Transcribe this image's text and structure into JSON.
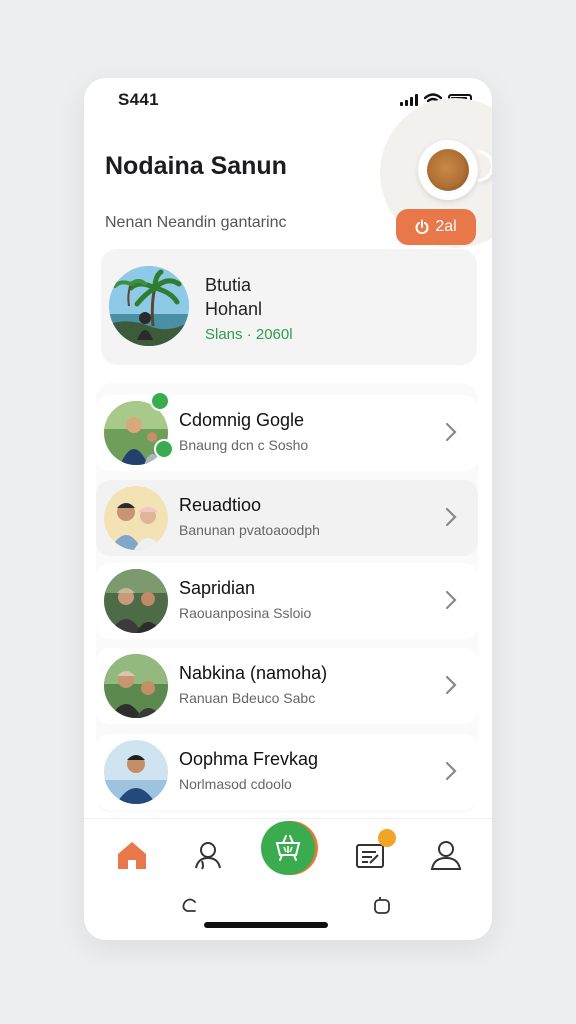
{
  "status_bar": {
    "time": "S441"
  },
  "header": {
    "title": "Nodaina Sanun",
    "subtitle": "Nenan Neandin gantarinc",
    "badge_icon": "power-icon",
    "badge_label": "2al",
    "accent_color": "#e8774a"
  },
  "profile": {
    "name_line1": "Btutia",
    "name_line2": "Hohanl",
    "meta": "Slans · 2060l",
    "meta_color": "#2e9e4b"
  },
  "contacts": [
    {
      "name": "Cdomnig Gogle",
      "subtitle": "Bnaung dcn c Sosho"
    },
    {
      "name": "Reuadtioo",
      "subtitle": "Banunan pvatoaoodph"
    },
    {
      "name": "Sapridian",
      "subtitle": "Raouanposina Ssloio"
    },
    {
      "name": "Nabkina (namoha)",
      "subtitle": "Ranuan Bdeuco Sabc"
    },
    {
      "name": "Oophma Frevkag",
      "subtitle": "Norlmasod cdoolo"
    }
  ],
  "tab_bar": {
    "items": [
      {
        "icon": "home-icon",
        "active": true
      },
      {
        "icon": "contacts-icon",
        "active": false
      },
      {
        "icon": "basket-icon",
        "active": false
      },
      {
        "icon": "tasks-icon",
        "active": false
      },
      {
        "icon": "profile-icon",
        "active": false
      }
    ],
    "active_color": "#e8774a",
    "center_color": "#3aab4f"
  }
}
